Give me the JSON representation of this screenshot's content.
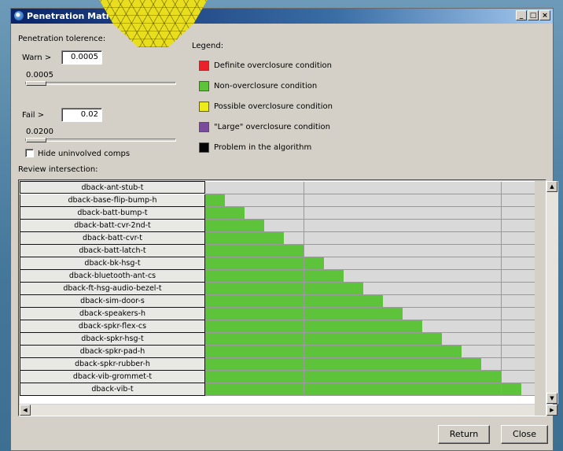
{
  "window": {
    "title": "Penetration Matrix",
    "controls": {
      "minimize": "_",
      "maximize": "□",
      "close": "×"
    }
  },
  "tolerance": {
    "heading": "Penetration tolerence:",
    "warn_label": "Warn >",
    "warn_value": "0.0005",
    "warn_slider_value": "0.0005",
    "fail_label": "Fail >",
    "fail_value": "0.02",
    "fail_slider_value": "0.0200",
    "hide_checkbox_label": "Hide uninvolved comps",
    "hide_checked": false
  },
  "legend": {
    "heading": "Legend:",
    "items": [
      {
        "label": "Definite overclosure condition",
        "color": "#e8212b"
      },
      {
        "label": "Non-overclosure condition",
        "color": "#5cc33b"
      },
      {
        "label": "Possible overclosure condition",
        "color": "#ecec1c"
      },
      {
        "label": "\"Large\" overclosure condition",
        "color": "#7a4a9c"
      },
      {
        "label": "Problem in the algorithm",
        "color": "#050505"
      }
    ]
  },
  "review": {
    "heading": "Review intersection:",
    "components": [
      "dback-ant-stub-t",
      "dback-base-flip-bump-h",
      "dback-batt-bump-t",
      "dback-batt-cvr-2nd-t",
      "dback-batt-cvr-t",
      "dback-batt-latch-t",
      "dback-bk-hsg-t",
      "dback-bluetooth-ant-cs",
      "dback-ft-hsg-audio-bezel-t",
      "dback-sim-door-s",
      "dback-speakers-h",
      "dback-spkr-flex-cs",
      "dback-spkr-hsg-t",
      "dback-spkr-pad-h",
      "dback-spkr-rubber-h",
      "dback-vib-grommet-t",
      "dback-vib-t"
    ],
    "filled_color": "#5cc33b",
    "empty_color": "#d9d9d9",
    "visible_columns": 17
  },
  "buttons": {
    "return": "Return",
    "close": "Close"
  }
}
